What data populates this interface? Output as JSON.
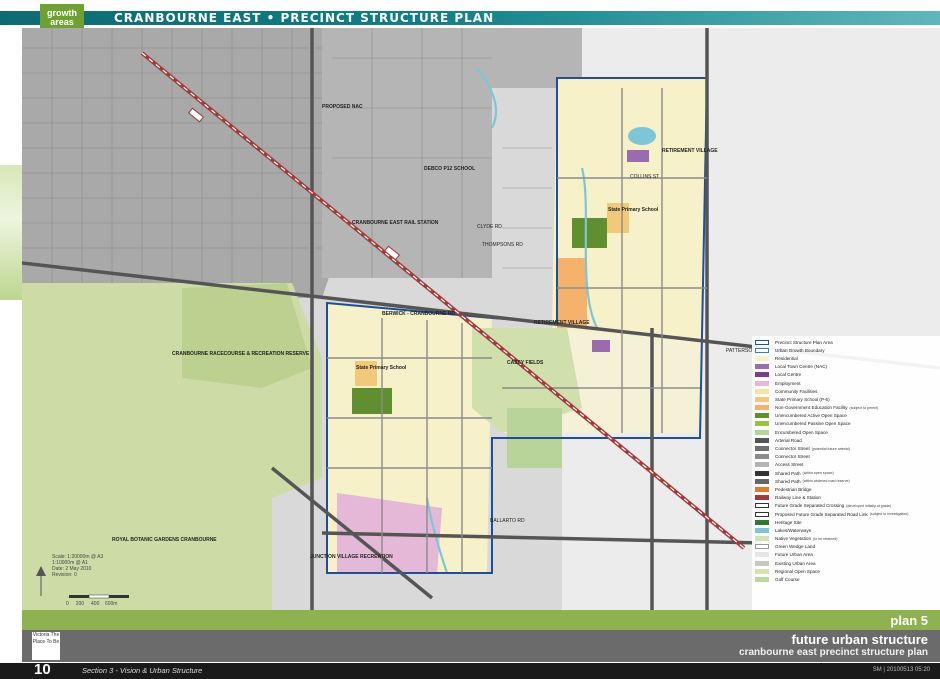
{
  "header": {
    "logo_line1": "growth",
    "logo_line2": "areas",
    "title": "CRANBOURNE EAST • PRECINCT STRUCTURE PLAN"
  },
  "map_labels": {
    "nac": "PROPOSED NAC",
    "railway_station": "CRANBOURNE EAST RAIL STATION",
    "debco": "DEBCO P12 SCHOOL",
    "retirement_village_n": "RETIREMENT VILLAGE",
    "retirement_village_c": "RETIREMENT VILLAGE",
    "state_school_n": "State Primary School",
    "state_school_w": "State Primary School",
    "collins_st": "COLLINS ST",
    "pattersons_rd": "PATTERSONS RD",
    "berwick_rd": "BERWICK - CRANBOURNE RD",
    "ballarto_rd": "BALLARTO RD",
    "casey_fields": "CASEY FIELDS",
    "racecourse": "CRANBOURNE RACECOURSE & RECREATION RESERVE",
    "gardens": "ROYAL BOTANIC GARDENS CRANBOURNE",
    "junction_village": "JUNCTION VILLAGE RECREATION",
    "clyde_rd": "CLYDE RD",
    "thompsons_rd": "THOMPSONS RD"
  },
  "scale": {
    "line1": "Scale: 1:20000m @ A3",
    "line2": "1:10000m @ A1",
    "line3": "Date: 2 May 2010",
    "line4": "Revision: 0",
    "ticks": [
      "0",
      "200",
      "400",
      "600m"
    ]
  },
  "legend": [
    {
      "label": "Precinct Structure Plan Area",
      "note": "",
      "color": "#ffffff",
      "border": "#1f4e9a"
    },
    {
      "label": "Urban Growth Boundary",
      "note": "",
      "color": "#ffffff",
      "border": "#3a7cc1"
    },
    {
      "label": "Residential",
      "note": "",
      "color": "#f6f1c9",
      "border": ""
    },
    {
      "label": "Local Town Centre (NAC)",
      "note": "",
      "color": "#9b6bb0",
      "border": ""
    },
    {
      "label": "Local Centre",
      "note": "",
      "color": "#7a3e8f",
      "border": ""
    },
    {
      "label": "Employment",
      "note": "",
      "color": "#e4b8d6",
      "border": ""
    },
    {
      "label": "Community Facilities",
      "note": "",
      "color": "#f3e6a1",
      "border": ""
    },
    {
      "label": "State Primary School (P-6)",
      "note": "",
      "color": "#f2c97a",
      "border": ""
    },
    {
      "label": "Non-Government Education Facility",
      "note": "(subject to permit)",
      "color": "#f5b26b",
      "border": ""
    },
    {
      "label": "Unencumbered Active Open Space",
      "note": "",
      "color": "#5f8f2f",
      "border": ""
    },
    {
      "label": "Unencumbered Passive Open Space",
      "note": "",
      "color": "#9fbf4c",
      "border": ""
    },
    {
      "label": "Encumbered Open Space",
      "note": "",
      "color": "#b8d49a",
      "border": ""
    },
    {
      "label": "Arterial Road",
      "note": "",
      "color": "#555555",
      "border": ""
    },
    {
      "label": "Connector Street",
      "note": "(potential future arterial)",
      "color": "#6f6f6f",
      "border": ""
    },
    {
      "label": "Connector Street",
      "note": "",
      "color": "#8c8c8c",
      "border": ""
    },
    {
      "label": "Access Street",
      "note": "",
      "color": "#b4b4b4",
      "border": ""
    },
    {
      "label": "Shared Path",
      "note": "(within open space)",
      "color": "#333333",
      "border": ""
    },
    {
      "label": "Shared Path",
      "note": "(within widened road reserve)",
      "color": "#666666",
      "border": ""
    },
    {
      "label": "Pedestrian Bridge",
      "note": "",
      "color": "#e07b2a",
      "border": ""
    },
    {
      "label": "Railway Line & Station",
      "note": "",
      "color": "#a23a3a",
      "border": ""
    },
    {
      "label": "Future Grade Separated Crossing",
      "note": "(developed initially at grade)",
      "color": "#ffffff",
      "border": "#333333"
    },
    {
      "label": "Proposed Future Grade Separated Road Link",
      "note": "(subject to investigation)",
      "color": "#ffffff",
      "border": "#333333"
    },
    {
      "label": "Heritage Site",
      "note": "",
      "color": "#2f7a2f",
      "border": ""
    },
    {
      "label": "Lakes/Waterways",
      "note": "",
      "color": "#7cc6d8",
      "border": ""
    },
    {
      "label": "Native Vegetation",
      "note": "(to be retained)",
      "color": "#cfe3b4",
      "border": ""
    },
    {
      "label": "Green Wedge Land",
      "note": "",
      "color": "#ffffff",
      "border": "#999999"
    },
    {
      "label": "Future Urban Area",
      "note": "",
      "color": "#e6e6e6",
      "border": ""
    },
    {
      "label": "Existing Urban Area",
      "note": "",
      "color": "#c6c6c6",
      "border": ""
    },
    {
      "label": "Regional Open Space",
      "note": "",
      "color": "#d3e3ae",
      "border": ""
    },
    {
      "label": "Golf Course",
      "note": "",
      "color": "#bfd6a0",
      "border": ""
    }
  ],
  "plan_band": {
    "label": "plan 5"
  },
  "title_band": {
    "title": "future urban structure",
    "subtitle": "cranbourne east precinct structure plan",
    "victoria_logo": "Victoria The Place To Be"
  },
  "footer": {
    "page_number": "10",
    "section": "Section 3 - Vision & Urban Structure",
    "code": "SM | 20100513 05:20"
  }
}
